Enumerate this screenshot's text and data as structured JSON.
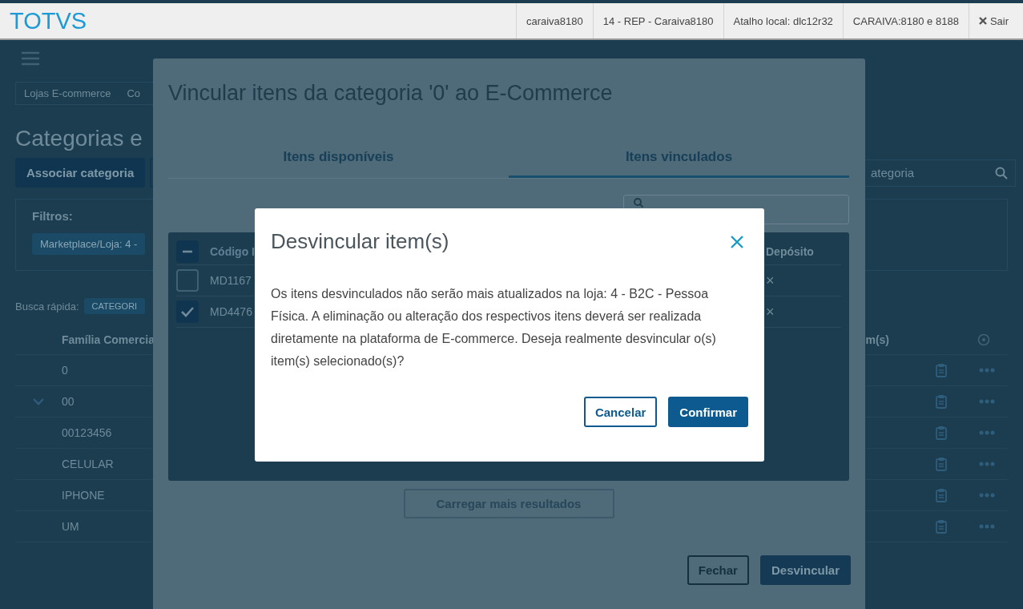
{
  "top_bar": {
    "logo": "TOTVS",
    "items": [
      "caraiva8180",
      "14 - REP - Caraiva8180",
      "Atalho local: dlc12r32",
      "CARAIVA:8180 e 8188"
    ],
    "logout": "Sair"
  },
  "page": {
    "breadcrumb": [
      "Lojas E-commerce",
      "Co"
    ],
    "title": "Categorias e",
    "button": "Associar categoria",
    "search": {
      "placeholder": "ategoria"
    },
    "filters": {
      "label": "Filtros:",
      "tags": [
        "Marketplace/Loja: 4 -"
      ]
    },
    "quick_search": {
      "label": "Busca rápida:",
      "tags": [
        "CATEGORI"
      ]
    },
    "table": {
      "columns": [
        "Família Comercia",
        "m(s)"
      ],
      "rows": [
        {
          "name": "0",
          "expandable": false
        },
        {
          "name": "00",
          "expandable": true
        },
        {
          "name": "00123456",
          "expandable": false
        },
        {
          "name": "CELULAR",
          "expandable": false
        },
        {
          "name": "IPHONE",
          "expandable": false
        },
        {
          "name": "UM",
          "expandable": false
        }
      ]
    }
  },
  "link_modal": {
    "title": "Vincular itens da categoria '0' ao E-Commerce",
    "tabs": [
      {
        "label": "Itens disponíveis",
        "selected": false
      },
      {
        "label": "Itens vinculados",
        "selected": true
      }
    ],
    "table": {
      "header_indeterminate": true,
      "columns": [
        "Código I",
        "Depósito"
      ],
      "rows": [
        {
          "code": "MD1167",
          "checked": false,
          "deposit": "×"
        },
        {
          "code": "MD4476",
          "checked": true,
          "deposit": "×"
        }
      ]
    },
    "load_more": "Carregar mais resultados",
    "buttons": [
      {
        "label": "Fechar",
        "kind": "secondary"
      },
      {
        "label": "Desvincular",
        "kind": "primary"
      }
    ]
  },
  "confirm_dialog": {
    "title": "Desvincular item(s)",
    "message": "Os itens desvinculados não serão mais atualizados na loja: 4 - B2C - Pessoa Física. A eliminação ou alteração dos respectivos itens deverá ser realizada diretamente na plataforma de E-commerce. Deseja realmente desvincular o(s) item(s) selecionado(s)?",
    "buttons": [
      {
        "label": "Cancelar",
        "kind": "secondary"
      },
      {
        "label": "Confirmar",
        "kind": "primary"
      }
    ]
  }
}
